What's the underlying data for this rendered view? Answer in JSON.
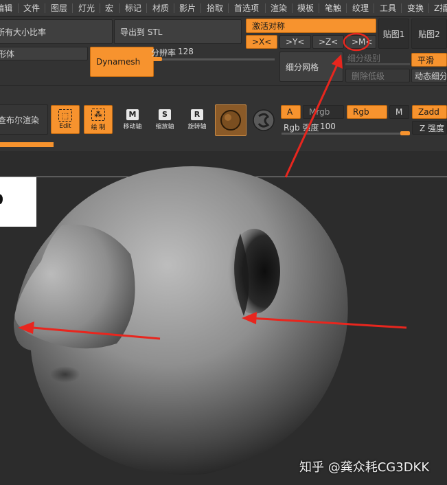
{
  "menu": [
    "编辑",
    "文件",
    "图层",
    "灯光",
    "宏",
    "标记",
    "材质",
    "影片",
    "拾取",
    "首选项",
    "渲染",
    "模板",
    "笔触",
    "纹理",
    "工具",
    "变换",
    "Z插"
  ],
  "toolbar": {
    "ratio_button": "所有大小比率",
    "export_stl": "导出到 STL",
    "activate_symmetry": "激活对称",
    "axis_x": ">X<",
    "axis_y": ">Y<",
    "axis_z": ">Z<",
    "axis_m": ">M<",
    "map1": "贴图1",
    "map2": "贴图2",
    "solid_partial": "形体",
    "dynamesh": "Dynamesh",
    "resolution_label": "分辨率",
    "resolution_value": "128",
    "subdiv_level": "细分级别",
    "subdiv_mesh": "细分网格",
    "delete_lower": "删除低级",
    "smooth": "平滑",
    "dynamic_subdiv": "动态细分",
    "bool_render": "查布尔渲染"
  },
  "tools": [
    {
      "glyph": "⬚",
      "label": "Edit",
      "active": true
    },
    {
      "glyph": "⁂",
      "label": "绘 制",
      "active": true
    },
    {
      "glyph": "M",
      "label": "移动轴",
      "active": false
    },
    {
      "glyph": "S",
      "label": "缩放轴",
      "active": false
    },
    {
      "glyph": "R",
      "label": "旋转轴",
      "active": false
    }
  ],
  "material": {
    "a": "A",
    "mrgb": "Mrgb",
    "rgb": "Rgb",
    "m": "M",
    "zadd": "Zadd",
    "rgb_intensity_label": "Rgb 强度",
    "rgb_intensity_value": "100",
    "z_intensity_label": "Z 强度"
  },
  "watermark": "知乎 @龚众耗CG3DKK",
  "colors": {
    "accent": "#f7932e",
    "annotation": "#e8261e"
  }
}
